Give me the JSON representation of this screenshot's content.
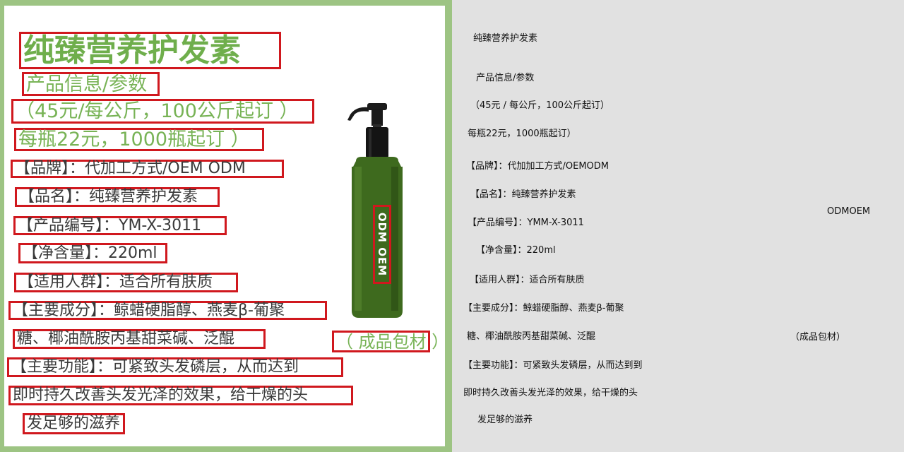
{
  "poster": {
    "title": "纯臻营养护发素",
    "subtitle": "产品信息/参数",
    "price_kg": "（45元/每公斤，100公斤起订 ）",
    "price_bottle": "每瓶22元，1000瓶起订 ）",
    "brand": "【品牌】：代加工方式/OEM ODM",
    "name": "【品名】：纯臻营养护发素",
    "code": "【产品编号】：YM-X-3011",
    "net": "【净含量】：220ml",
    "users": "【适用人群】：适合所有肤质",
    "ingredients_1": "【主要成分】：鲸蜡硬脂醇、燕麦β-葡聚",
    "ingredients_2": "糖、椰油酰胺丙基甜菜碱、泛醌",
    "function_1": "【主要功能】：可紧致头发磷层，从而达到",
    "function_2": "即时持久改善头发光泽的效果，给干燥的头",
    "function_3": "发足够的滋养",
    "bottle_label": "ODM OEM",
    "packaging": "（ 成品包材 ）"
  },
  "ocr": {
    "title": "纯臻营养护发素",
    "subtitle": "产品信息/参数",
    "price_kg": "（45元 / 每公斤，100公斤起订）",
    "price_bottle": "每瓶22元，1000瓶起订）",
    "brand": "【品牌】：代加加工方式/OEMODM",
    "name": "【品名】：纯臻营养护发素",
    "code": "【产品编号】：YMM-X-3011",
    "net": "【净含量】：220ml",
    "users": "【适用人群】：适合所有肤质",
    "ingredients_1": "【主要成分】：鲸蜡硬脂醇、燕麦β-葡聚",
    "ingredients_2": "糖、椰油酰胺丙基甜菜碱、泛醌",
    "function_1": "【主要功能】：可紧致头发磷层，从而达到到",
    "function_2": "即时持久改善头发光泽的效果，给干燥的头",
    "function_3": "发足够的滋养",
    "bottle_label": "ODMOEM",
    "packaging": "（成品包材）"
  },
  "colors": {
    "green_text": "#6fae4c",
    "box_red": "#d0181e",
    "frame_green": "#9dc483",
    "panel_gray": "#e1e1e1"
  }
}
